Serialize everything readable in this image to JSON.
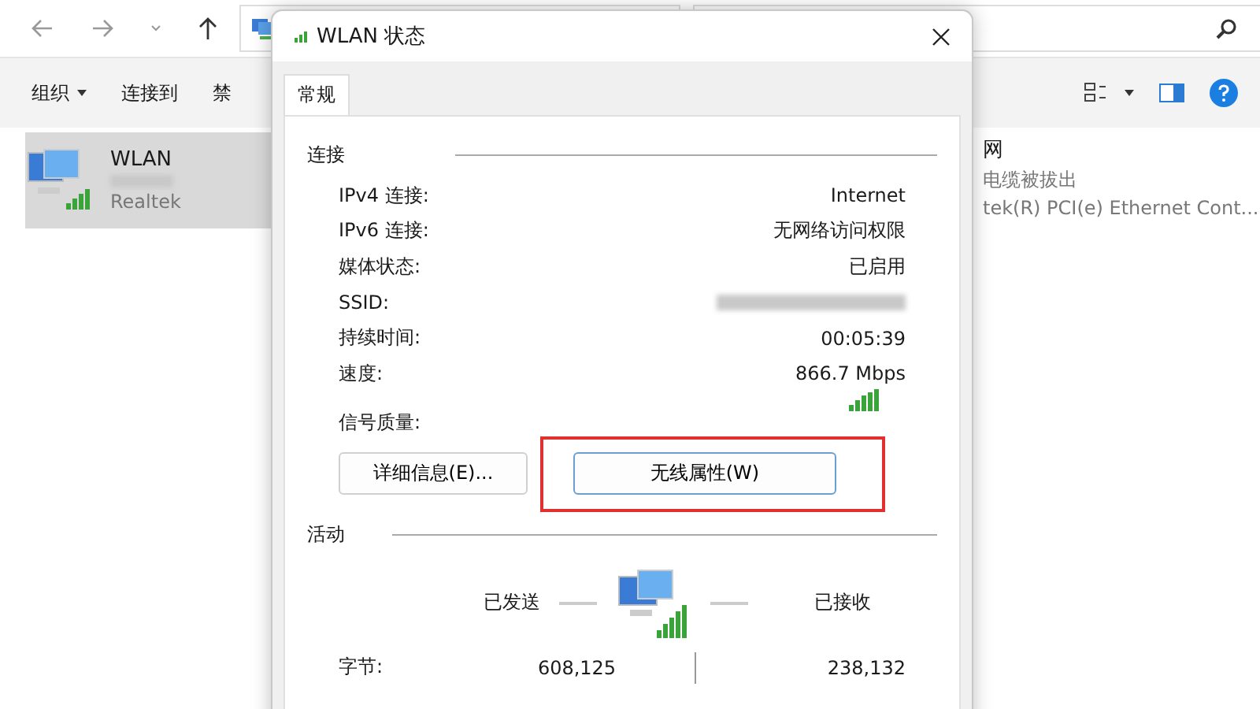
{
  "explorer": {
    "toolbar": [
      {
        "label": "组织",
        "dropdown": true
      },
      {
        "label": "连接到",
        "dropdown": false
      },
      {
        "label": "禁",
        "dropdown": false
      }
    ],
    "adapters": [
      {
        "name": "WLAN",
        "device": "Realtek",
        "selected": true,
        "kind": "wifi"
      },
      {
        "name": "网",
        "status": "电缆被拔出",
        "device": "tek(R) PCI(e) Ethernet Cont...",
        "selected": false,
        "kind": "ethernet"
      }
    ]
  },
  "dialog": {
    "title": "WLAN 状态",
    "tabs": [
      {
        "label": "常规",
        "selected": true
      }
    ],
    "connection": {
      "heading": "连接",
      "rows": [
        {
          "label": "IPv4 连接:",
          "value": "Internet",
          "kind": "text"
        },
        {
          "label": "IPv6 连接:",
          "value": "无网络访问权限",
          "kind": "text"
        },
        {
          "label": "媒体状态:",
          "value": "已启用",
          "kind": "text"
        },
        {
          "label": "SSID:",
          "kind": "redacted"
        },
        {
          "label": "持续时间:",
          "value": "00:05:39",
          "kind": "text"
        },
        {
          "label": "速度:",
          "value": "866.7 Mbps",
          "kind": "text"
        },
        {
          "label": "信号质量:",
          "kind": "signal"
        }
      ]
    },
    "buttons": [
      {
        "label": "详细信息(E)...",
        "highlighted": false
      },
      {
        "label": "无线属性(W)",
        "highlighted": true
      }
    ],
    "activity": {
      "heading": "活动",
      "sent_label": "已发送",
      "received_label": "已接收",
      "bytes_label": "字节:",
      "sent": "608,125",
      "received": "238,132"
    }
  }
}
